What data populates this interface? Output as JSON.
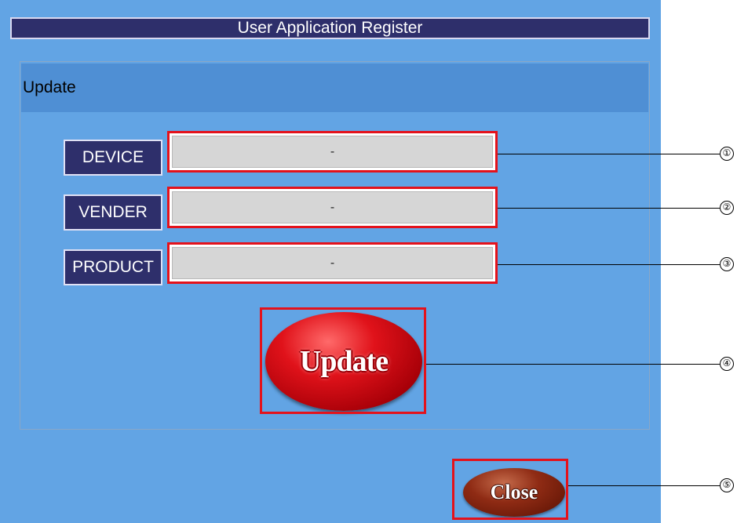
{
  "window": {
    "title": "User Application Register"
  },
  "section": {
    "title": "Update"
  },
  "fields": [
    {
      "label": "DEVICE",
      "value": "-"
    },
    {
      "label": "VENDER",
      "value": "-"
    },
    {
      "label": "PRODUCT",
      "value": "-"
    }
  ],
  "buttons": {
    "update_label": "Update",
    "close_label": "Close"
  },
  "callouts": [
    "①",
    "②",
    "③",
    "④",
    "⑤"
  ],
  "colors": {
    "panel_background": "#62a4e4",
    "title_bar": "#2e2f6b",
    "highlight_box": "#e4121b",
    "update_button": "#e0121a",
    "close_button": "#8f2b14"
  }
}
